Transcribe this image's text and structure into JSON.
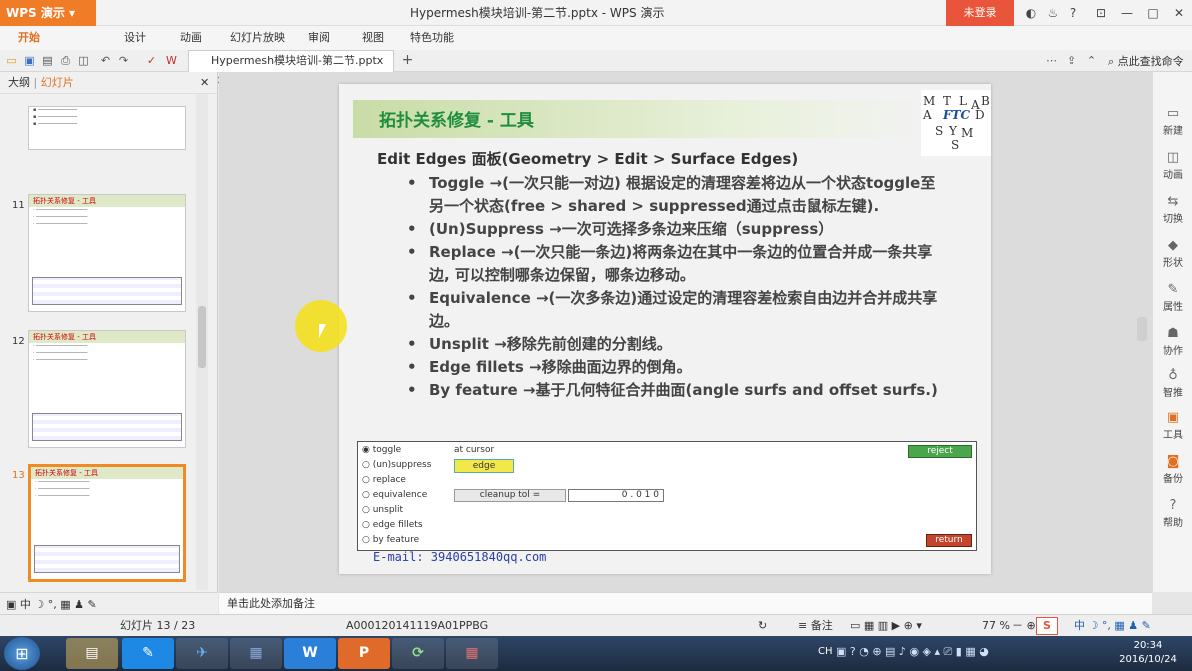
{
  "app": {
    "wps_label": "WPS 演示",
    "doc_title": "Hypermesh模块培训-第二节.pptx - WPS 演示",
    "login": "未登录"
  },
  "ribbon": {
    "tabs": [
      "开始",
      "设计",
      "动画",
      "幻灯片放映",
      "审阅",
      "视图",
      "特色功能"
    ]
  },
  "qat": {
    "doc_tab": "Hypermesh模块培训-第二节.pptx",
    "search_cmd": "点此查找命令"
  },
  "left_panel": {
    "tab_outline": "大纲",
    "tab_slides": "幻灯片",
    "slides": [
      {
        "num": "11",
        "title": "拓扑关系修复 - 工具"
      },
      {
        "num": "12",
        "title": "拓扑关系修复 - 工具"
      },
      {
        "num": "13",
        "title": "拓扑关系修复 - 工具"
      }
    ]
  },
  "slide": {
    "title": "拓扑关系修复 - 工具",
    "logo_letters": [
      "M",
      "T",
      "L",
      "A",
      "B",
      "D",
      "A",
      "FTC",
      "S",
      "Y",
      "M",
      "S"
    ],
    "subtitle": "Edit Edges 面板(Geometry > Edit > Surface Edges)",
    "bullets": [
      "Toggle →(一次只能一对边) 根据设定的清理容差将边从一个状态toggle至另一个状态(free > shared > suppressed通过点击鼠标左键).",
      "(Un)Suppress →一次可选择多条边来压缩（suppress）",
      "Replace →(一次只能一条边)将两条边在其中一条边的位置合并成一条共享边, 可以控制哪条边保留，哪条边移动。",
      "Equivalence →(一次多条边)通过设定的清理容差检索自由边并合并成共享边。",
      "Unsplit →移除先前创建的分割线。",
      "Edge fillets →移除曲面边界的倒角。",
      "By feature →基于几何特征合并曲面(angle surfs and offset surfs.)"
    ],
    "dialog": {
      "options": [
        "toggle",
        "(un)suppress",
        "replace",
        "equivalence",
        "unsplit",
        "edge fillets",
        "by feature"
      ],
      "at_cursor": "at cursor",
      "edge_btn": "edge",
      "cleanup_label": "cleanup tol =",
      "cleanup_value": "0 . 0 1 0",
      "reject": "reject",
      "return": "return"
    },
    "email": "E-mail: 3940651840qq.com"
  },
  "right_panel": {
    "items": [
      "新建",
      "动画",
      "切换",
      "形状",
      "属性",
      "协作",
      "智推",
      "工具",
      "备份",
      "帮助"
    ]
  },
  "notes": {
    "placeholder": "单击此处添加备注"
  },
  "status": {
    "slide_counter": "幻灯片 13 / 23",
    "template": "A000120141119A01PPBG",
    "notes_btn": "备注",
    "zoom": "77 %"
  },
  "taskbar": {
    "time": "20:34",
    "date": "2016/10/24",
    "lang": "CH"
  }
}
